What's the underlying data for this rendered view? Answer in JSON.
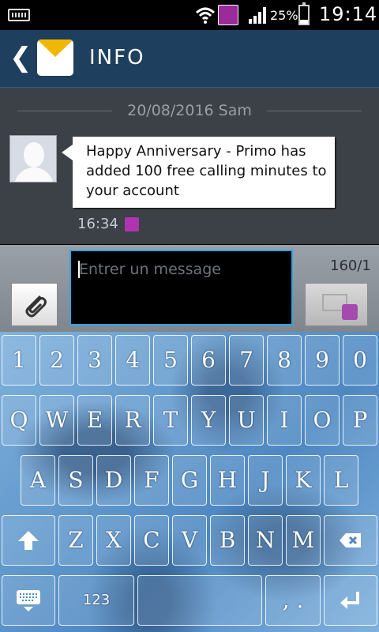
{
  "status": {
    "battery": "25%",
    "battery_fill": 0.25,
    "time": "19:14"
  },
  "header": {
    "title": "INFO"
  },
  "conversation": {
    "date_label": "20/08/2016 Sam",
    "message": "Happy Anniversary - Primo has added 100 free calling minutes to your account",
    "timestamp": "16:34"
  },
  "composer": {
    "placeholder": "Entrer un message",
    "counter": "160/1"
  },
  "keyboard": {
    "row1": [
      "1",
      "2",
      "3",
      "4",
      "5",
      "6",
      "7",
      "8",
      "9",
      "0"
    ],
    "row2": [
      "Q",
      "W",
      "E",
      "R",
      "T",
      "Y",
      "U",
      "I",
      "O",
      "P"
    ],
    "row3": [
      "A",
      "S",
      "D",
      "F",
      "G",
      "H",
      "J",
      "K",
      "L"
    ],
    "row4": [
      "Z",
      "X",
      "C",
      "V",
      "B",
      "N",
      "M"
    ],
    "numbers_key": "123",
    "punct_key": ", ."
  },
  "icons": {
    "back": "chevron-left-icon",
    "app": "envelope-icon",
    "attach": "paperclip-icon",
    "send": "send-message-icon",
    "shift": "shift-icon",
    "delete": "backspace-icon",
    "keyboard_settings": "keyboard-icon",
    "enter": "enter-icon"
  }
}
